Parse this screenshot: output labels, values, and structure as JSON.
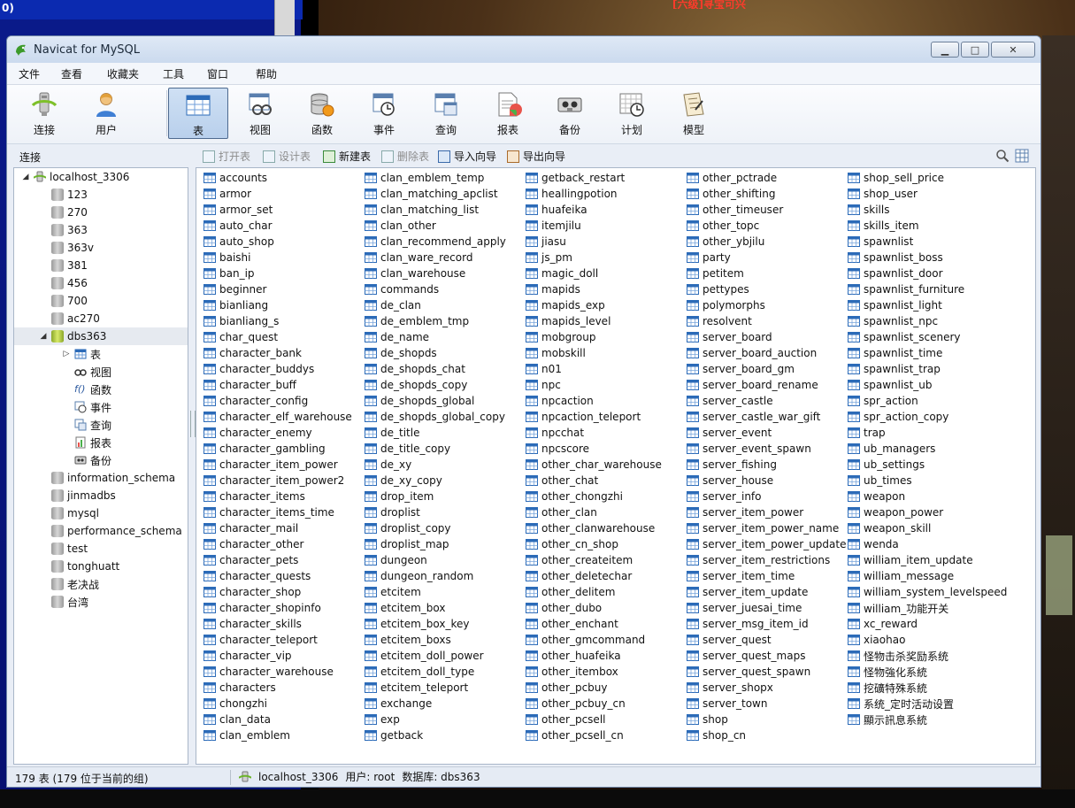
{
  "window": {
    "title": "Navicat for MySQL"
  },
  "background": {
    "top_left_text": "0)",
    "game_banner": "[六级]寻宝可兴"
  },
  "menu": [
    "文件",
    "查看",
    "收藏夹",
    "工具",
    "窗口",
    "帮助"
  ],
  "toolbar": {
    "left": [
      {
        "label": "连接",
        "icon": "connection-icon"
      },
      {
        "label": "用户",
        "icon": "user-icon"
      }
    ],
    "right": [
      {
        "label": "表",
        "icon": "table-icon",
        "active": true
      },
      {
        "label": "视图",
        "icon": "view-icon"
      },
      {
        "label": "函数",
        "icon": "function-icon"
      },
      {
        "label": "事件",
        "icon": "event-icon"
      },
      {
        "label": "查询",
        "icon": "query-icon"
      },
      {
        "label": "报表",
        "icon": "report-icon"
      },
      {
        "label": "备份",
        "icon": "backup-icon"
      },
      {
        "label": "计划",
        "icon": "schedule-icon"
      },
      {
        "label": "模型",
        "icon": "model-icon"
      }
    ]
  },
  "panel_label": "连接",
  "subtoolbar": [
    {
      "label": "打开表",
      "enabled": false
    },
    {
      "label": "设计表",
      "enabled": false
    },
    {
      "label": "新建表",
      "enabled": true
    },
    {
      "label": "删除表",
      "enabled": false
    },
    {
      "label": "导入向导",
      "enabled": true
    },
    {
      "label": "导出向导",
      "enabled": true
    }
  ],
  "tree": {
    "connection": "localhost_3306",
    "databases_before": [
      "123",
      "270",
      "363",
      "363v",
      "381",
      "456",
      "700",
      "ac270"
    ],
    "open_database": "dbs363",
    "open_children": [
      "表",
      "视图",
      "函数",
      "事件",
      "查询",
      "报表",
      "备份"
    ],
    "databases_after": [
      "information_schema",
      "jinmadbs",
      "mysql",
      "performance_schema",
      "test",
      "tonghuatt",
      "老决战",
      "台湾"
    ]
  },
  "tables": [
    [
      "accounts",
      "armor",
      "armor_set",
      "auto_char",
      "auto_shop",
      "baishi",
      "ban_ip",
      "beginner",
      "bianliang",
      "bianliang_s",
      "char_quest",
      "character_bank",
      "character_buddys",
      "character_buff",
      "character_config",
      "character_elf_warehouse",
      "character_enemy",
      "character_gambling",
      "character_item_power",
      "character_item_power2",
      "character_items",
      "character_items_time",
      "character_mail",
      "character_other",
      "character_pets",
      "character_quests",
      "character_shop",
      "character_shopinfo",
      "character_skills",
      "character_teleport",
      "character_vip",
      "character_warehouse",
      "characters",
      "chongzhi",
      "clan_data",
      "clan_emblem"
    ],
    [
      "clan_emblem_temp",
      "clan_matching_apclist",
      "clan_matching_list",
      "clan_other",
      "clan_recommend_apply",
      "clan_ware_record",
      "clan_warehouse",
      "commands",
      "de_clan",
      "de_emblem_tmp",
      "de_name",
      "de_shopds",
      "de_shopds_chat",
      "de_shopds_copy",
      "de_shopds_global",
      "de_shopds_global_copy",
      "de_title",
      "de_title_copy",
      "de_xy",
      "de_xy_copy",
      "drop_item",
      "droplist",
      "droplist_copy",
      "droplist_map",
      "dungeon",
      "dungeon_random",
      "etcitem",
      "etcitem_box",
      "etcitem_box_key",
      "etcitem_boxs",
      "etcitem_doll_power",
      "etcitem_doll_type",
      "etcitem_teleport",
      "exchange",
      "exp",
      "getback"
    ],
    [
      "getback_restart",
      "heallingpotion",
      "huafeika",
      "itemjilu",
      "jiasu",
      "js_pm",
      "magic_doll",
      "mapids",
      "mapids_exp",
      "mapids_level",
      "mobgroup",
      "mobskill",
      "n01",
      "npc",
      "npcaction",
      "npcaction_teleport",
      "npcchat",
      "npcscore",
      "other_char_warehouse",
      "other_chat",
      "other_chongzhi",
      "other_clan",
      "other_clanwarehouse",
      "other_cn_shop",
      "other_createitem",
      "other_deletechar",
      "other_delitem",
      "other_dubo",
      "other_enchant",
      "other_gmcommand",
      "other_huafeika",
      "other_itembox",
      "other_pcbuy",
      "other_pcbuy_cn",
      "other_pcsell",
      "other_pcsell_cn"
    ],
    [
      "other_pctrade",
      "other_shifting",
      "other_timeuser",
      "other_topc",
      "other_ybjilu",
      "party",
      "petitem",
      "pettypes",
      "polymorphs",
      "resolvent",
      "server_board",
      "server_board_auction",
      "server_board_gm",
      "server_board_rename",
      "server_castle",
      "server_castle_war_gift",
      "server_event",
      "server_event_spawn",
      "server_fishing",
      "server_house",
      "server_info",
      "server_item_power",
      "server_item_power_name",
      "server_item_power_update",
      "server_item_restrictions",
      "server_item_time",
      "server_item_update",
      "server_juesai_time",
      "server_msg_item_id",
      "server_quest",
      "server_quest_maps",
      "server_quest_spawn",
      "server_shopx",
      "server_town",
      "shop",
      "shop_cn"
    ],
    [
      "shop_sell_price",
      "shop_user",
      "skills",
      "skills_item",
      "spawnlist",
      "spawnlist_boss",
      "spawnlist_door",
      "spawnlist_furniture",
      "spawnlist_light",
      "spawnlist_npc",
      "spawnlist_scenery",
      "spawnlist_time",
      "spawnlist_trap",
      "spawnlist_ub",
      "spr_action",
      "spr_action_copy",
      "trap",
      "ub_managers",
      "ub_settings",
      "ub_times",
      "weapon",
      "weapon_power",
      "weapon_skill",
      "wenda",
      "william_item_update",
      "william_message",
      "william_system_levelspeed",
      "william_功能开关",
      "xc_reward",
      "xiaohao",
      "怪物击杀奖励系统",
      "怪物強化系統",
      "挖礦特殊系統",
      "系统_定时活动设置",
      "顯示訊息系統"
    ]
  ],
  "status": {
    "count": "179 表 (179 位于当前的组)",
    "connection": "localhost_3306",
    "user": "用户: root",
    "database": "数据库: dbs363"
  }
}
